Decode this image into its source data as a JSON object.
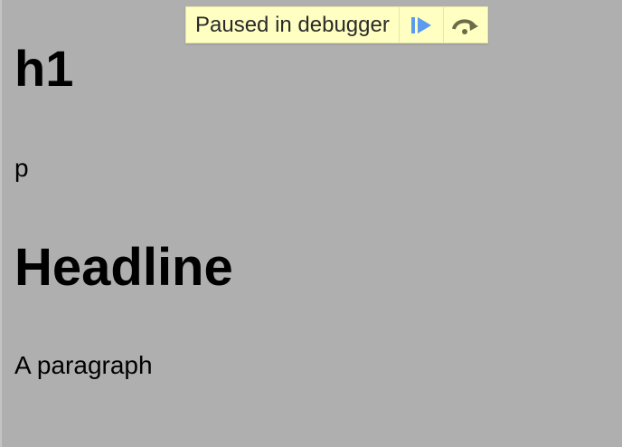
{
  "page": {
    "heading_small": "h1",
    "paragraph_small": "p",
    "heading_big": "Headline",
    "paragraph_big": "A paragraph"
  },
  "debugger": {
    "label": "Paused in debugger",
    "resume_icon": "resume-icon",
    "step_over_icon": "step-over-icon",
    "colors": {
      "bar_background": "#ffffc2",
      "resume_icon": "#5a9bf0",
      "step_over_icon": "#6b6b4a"
    }
  },
  "colors": {
    "overlay_background": "#afafaf"
  }
}
